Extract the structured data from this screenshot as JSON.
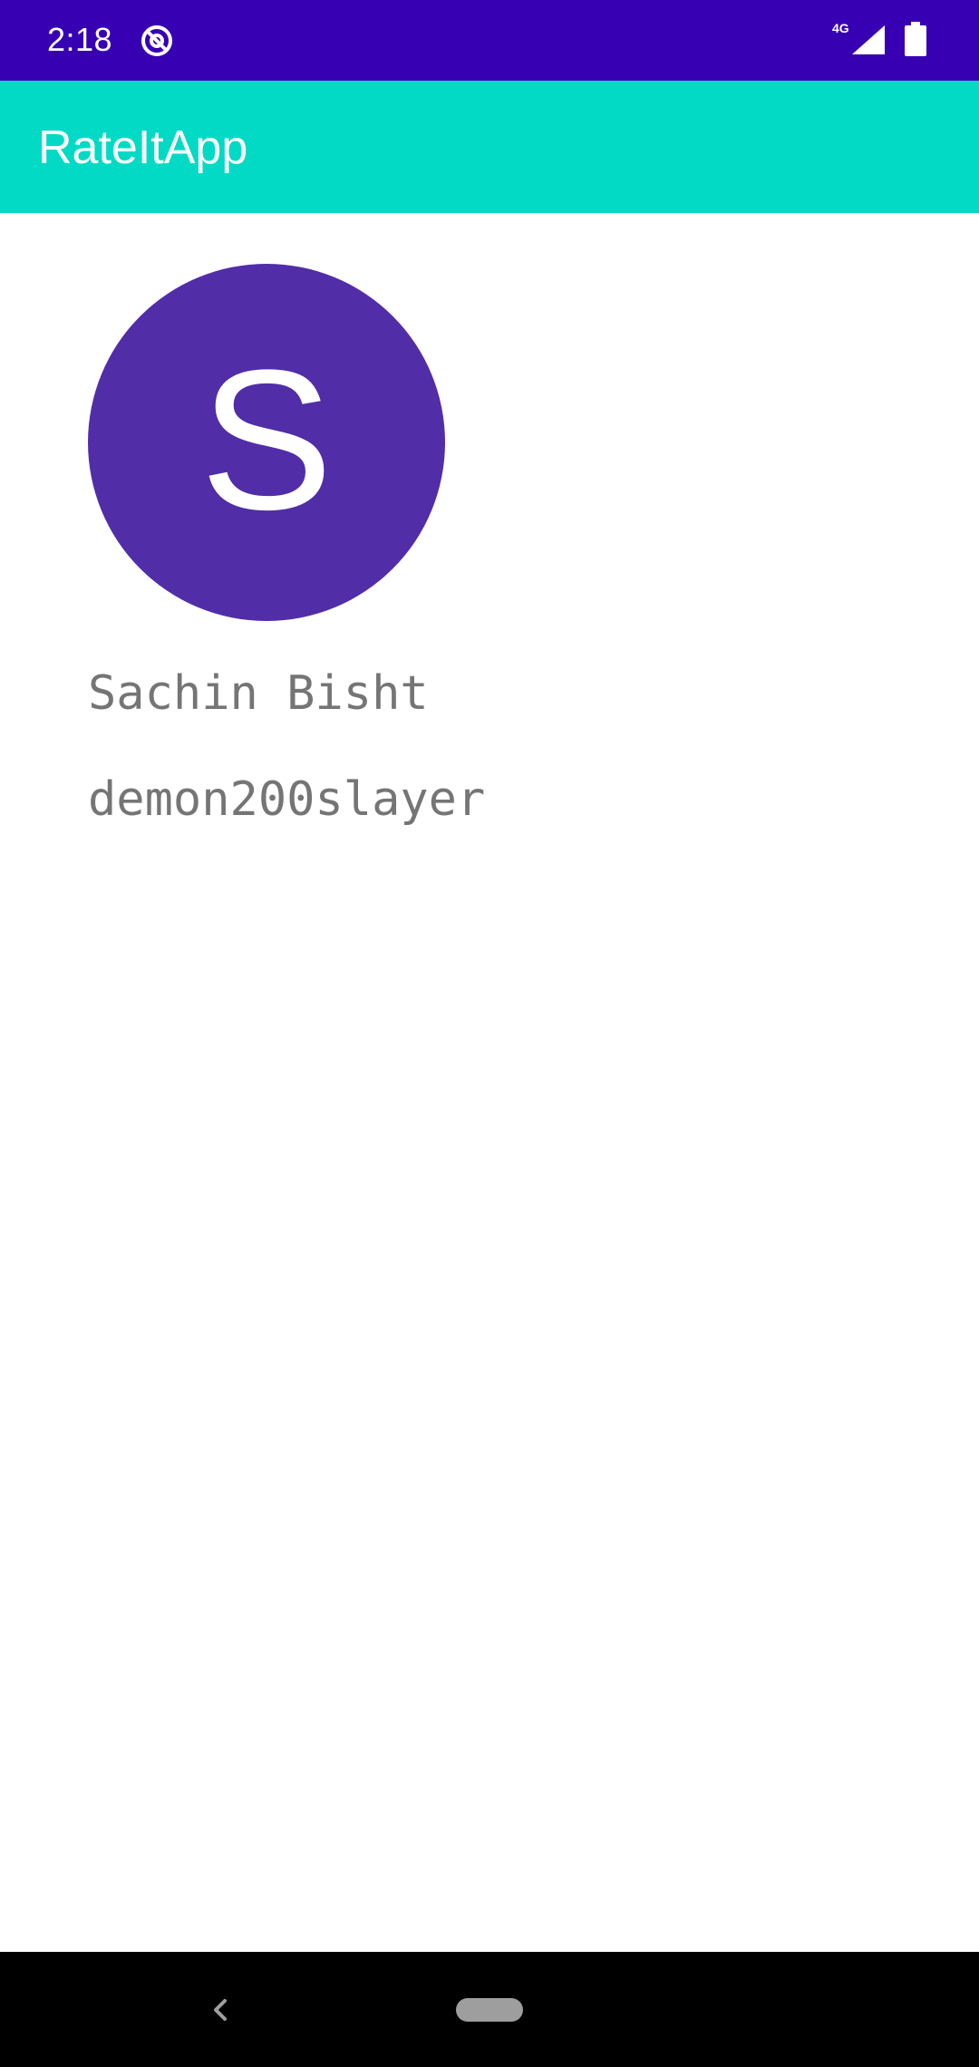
{
  "status_bar": {
    "time": "2:18",
    "network_type": "4G",
    "notification_icon": "at-sign-icon",
    "signal_icon": "cell-signal-icon",
    "battery_icon": "battery-full-icon",
    "background_color": "#3700B3"
  },
  "app_bar": {
    "title": "RateItApp",
    "background_color": "#03DAC5"
  },
  "profile": {
    "avatar_letter": "S",
    "avatar_color": "#512DA8",
    "name": "Sachin Bisht",
    "username": "demon200slayer"
  },
  "nav_bar": {
    "back_icon": "chevron-left-icon",
    "home_icon": "home-pill-icon"
  }
}
